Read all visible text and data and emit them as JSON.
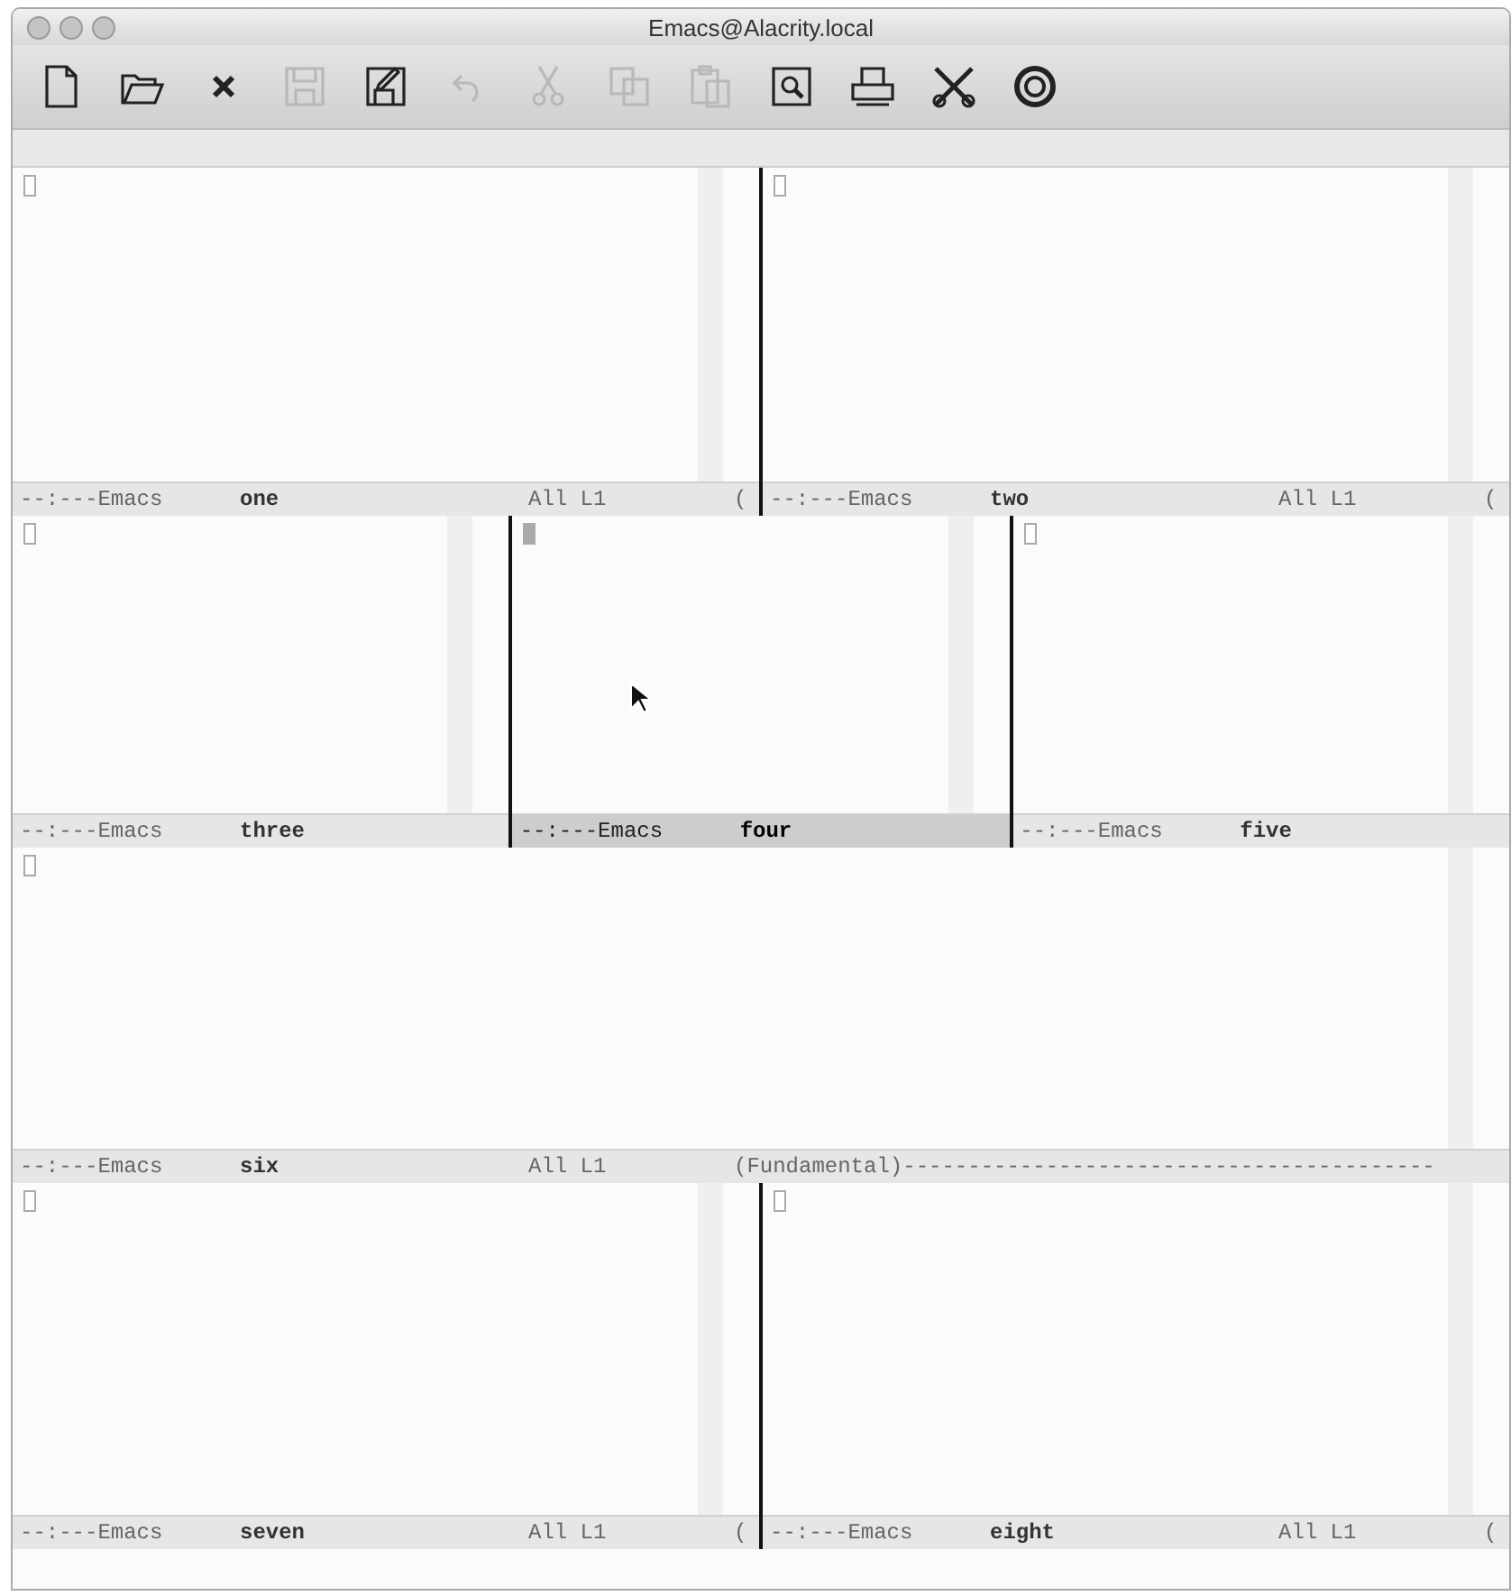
{
  "window": {
    "title": "Emacs@Alacrity.local"
  },
  "toolbar": [
    {
      "kind": "new",
      "disabled": false
    },
    {
      "kind": "open",
      "disabled": false
    },
    {
      "kind": "close",
      "disabled": false
    },
    {
      "kind": "save",
      "disabled": true
    },
    {
      "kind": "save-as",
      "disabled": false
    },
    {
      "kind": "undo",
      "disabled": true
    },
    {
      "kind": "cut",
      "disabled": true
    },
    {
      "kind": "copy",
      "disabled": true
    },
    {
      "kind": "paste",
      "disabled": true
    },
    {
      "kind": "search",
      "disabled": false
    },
    {
      "kind": "print",
      "disabled": false
    },
    {
      "kind": "tools",
      "disabled": false
    },
    {
      "kind": "help",
      "disabled": false
    }
  ],
  "rows": [
    {
      "windows": [
        {
          "prefix": "--:---Emacs",
          "buffer": "one",
          "position": "All L1",
          "mode": "(",
          "selected": false
        },
        {
          "prefix": "--:---Emacs",
          "buffer": "two",
          "position": "All L1",
          "mode": "(",
          "selected": false
        }
      ]
    },
    {
      "windows": [
        {
          "prefix": "--:---Emacs",
          "buffer": "three",
          "selected": false
        },
        {
          "prefix": "--:---Emacs",
          "buffer": "four",
          "selected": true
        },
        {
          "prefix": "--:---Emacs",
          "buffer": "five",
          "selected": false
        }
      ]
    },
    {
      "windows": [
        {
          "prefix": "--:---Emacs",
          "buffer": "six",
          "position": "All L1",
          "mode": "(Fundamental)-----------------------------------------",
          "selected": false
        }
      ]
    },
    {
      "windows": [
        {
          "prefix": "--:---Emacs",
          "buffer": "seven",
          "position": "All L1",
          "mode": "(",
          "selected": false
        },
        {
          "prefix": "--:---Emacs",
          "buffer": "eight",
          "position": "All L1",
          "mode": "(",
          "selected": false
        }
      ]
    }
  ]
}
